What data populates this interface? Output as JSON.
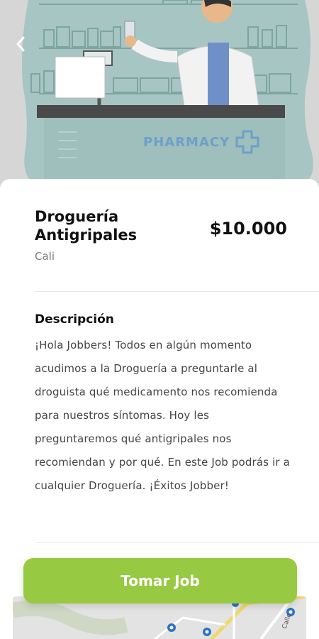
{
  "hero": {
    "sign_text": "PHARMACY"
  },
  "job": {
    "title": "Droguería Antigripales",
    "price": "$10.000",
    "city": "Cali"
  },
  "description": {
    "heading": "Descripción",
    "text": "¡Hola Jobbers! Todos en algún momento acudimos a la Droguería a preguntarle al droguista qué medicamento nos recomienda para nuestros síntomas. Hoy les preguntaremos qué antigripales nos recomiendan y por qué. En este Job podrás ir a cualquier Droguería. ¡Éxitos Jobber!"
  },
  "cta": {
    "label": "Tomar Job"
  },
  "map": {
    "street_label": "Calle"
  },
  "colors": {
    "accent": "#98c942",
    "illustration": "#8fb6b3"
  },
  "icons": [
    "back-arrow-icon",
    "pharmacy-cross-icon",
    "map-pin-icon"
  ]
}
